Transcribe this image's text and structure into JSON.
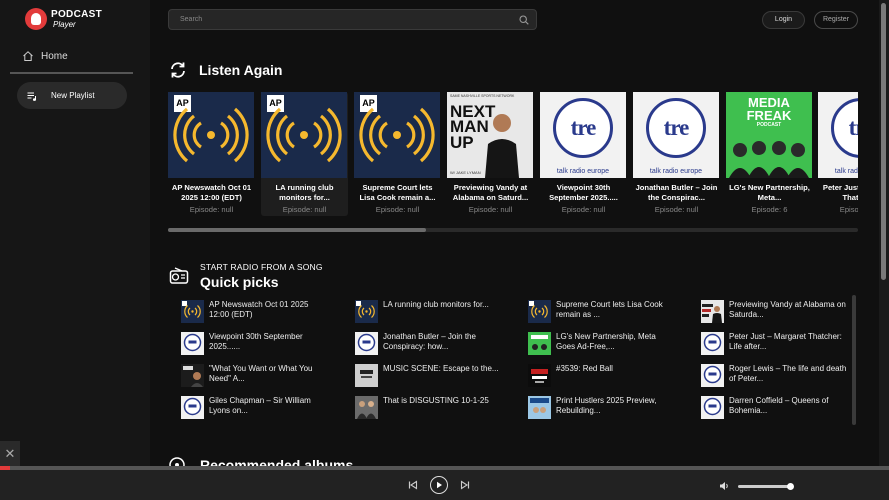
{
  "app": {
    "name": "PODCAST",
    "sub": "Player"
  },
  "sidebar": {
    "home": "Home",
    "new_playlist": "New Playlist"
  },
  "search": {
    "placeholder": "Search"
  },
  "auth": {
    "login": "Login",
    "register": "Register"
  },
  "listen_again": {
    "title": "Listen Again",
    "cards": [
      {
        "title": "AP Newswatch Oct 01 2025 12:00 (EDT)",
        "episode": "Episode: null",
        "art": "ap"
      },
      {
        "title": "LA running club monitors for...",
        "episode": "Episode: null",
        "art": "ap"
      },
      {
        "title": "Supreme Court lets Lisa Cook remain a...",
        "episode": "Episode: null",
        "art": "ap"
      },
      {
        "title": "Previewing Vandy at Alabama on Saturd...",
        "episode": "Episode: null",
        "art": "nmu"
      },
      {
        "title": "Viewpoint 30th September 2025.....",
        "episode": "Episode: null",
        "art": "tre"
      },
      {
        "title": "Jonathan Butler – Join the Conspirac...",
        "episode": "Episode: null",
        "art": "tre"
      },
      {
        "title": "LG's New Partnership, Meta...",
        "episode": "Episode: 6",
        "art": "mf"
      },
      {
        "title": "Peter Just – Margaret Thatcher...",
        "episode": "Episode: null",
        "art": "tre"
      }
    ],
    "art_text": {
      "ap": "AP",
      "tre": "tre",
      "tre_sub": "talk radio europe",
      "nmu_top": "SAME NASHVILLE SPORTS NETWORK",
      "nmu1": "NEXT",
      "nmu2": "MAN",
      "nmu3": "UP",
      "nmu_by": "W/ JAKE LYMAN",
      "mf1": "MEDIA",
      "mf2": "FREAK",
      "mf3": "PODCAST"
    }
  },
  "quick_picks": {
    "subtitle": "START RADIO FROM A SONG",
    "title": "Quick picks",
    "items": [
      {
        "title": "AP Newswatch Oct 01 2025 12:00 (EDT)",
        "art": "ap"
      },
      {
        "title": "LA running club monitors for...",
        "art": "ap"
      },
      {
        "title": "Supreme Court lets Lisa Cook remain as ...",
        "art": "ap"
      },
      {
        "title": "Previewing Vandy at Alabama on Saturda...",
        "art": "nmu"
      },
      {
        "title": "Viewpoint 30th September 2025......",
        "art": "tre"
      },
      {
        "title": "Jonathan Butler – Join the Conspiracy: how...",
        "art": "tre"
      },
      {
        "title": "LG's New Partnership, Meta Goes Ad-Free,...",
        "art": "mf"
      },
      {
        "title": "Peter Just – Margaret Thatcher: Life after...",
        "art": "tre"
      },
      {
        "title": "\"What You Want or What You Need\" A...",
        "art": "dark"
      },
      {
        "title": "MUSIC SCENE: Escape to the...",
        "art": "grey"
      },
      {
        "title": "#3539: Red Ball",
        "art": "red"
      },
      {
        "title": "Roger Lewis – The life and death of Peter...",
        "art": "tre"
      },
      {
        "title": "Giles Chapman – Sir William Lyons on...",
        "art": "tre"
      },
      {
        "title": "That is DISGUSTING 10-1-25",
        "art": "people"
      },
      {
        "title": "Print Hustlers 2025 Preview, Rebuilding...",
        "art": "blue"
      },
      {
        "title": "Darren Coffield – Queens of Bohemia...",
        "art": "tre"
      }
    ]
  },
  "recommended": {
    "title": "Recommended albums"
  },
  "colors": {
    "accent": "#e23b3b",
    "ap_yellow": "#f5b82e",
    "tre_blue": "#2a3a8c"
  }
}
